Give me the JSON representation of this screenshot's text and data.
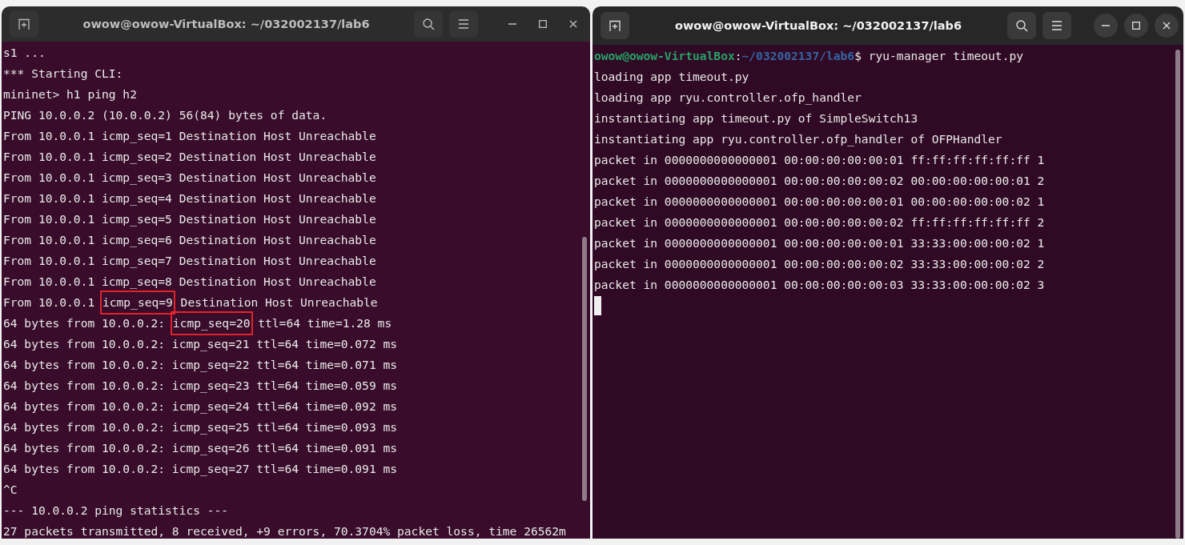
{
  "windows": [
    {
      "title": "owow@owow-VirtualBox: ~/032002137/lab6",
      "active": false,
      "lines": [
        {
          "parts": [
            {
              "kind": "plain",
              "text": "s1 ..."
            }
          ]
        },
        {
          "parts": [
            {
              "kind": "plain",
              "text": "*** Starting CLI:"
            }
          ]
        },
        {
          "parts": [
            {
              "kind": "plain",
              "text": "mininet> h1 ping h2"
            }
          ]
        },
        {
          "parts": [
            {
              "kind": "plain",
              "text": "PING 10.0.0.2 (10.0.0.2) 56(84) bytes of data."
            }
          ]
        },
        {
          "parts": [
            {
              "kind": "plain",
              "text": "From 10.0.0.1 icmp_seq=1 Destination Host Unreachable"
            }
          ]
        },
        {
          "parts": [
            {
              "kind": "plain",
              "text": "From 10.0.0.1 icmp_seq=2 Destination Host Unreachable"
            }
          ]
        },
        {
          "parts": [
            {
              "kind": "plain",
              "text": "From 10.0.0.1 icmp_seq=3 Destination Host Unreachable"
            }
          ]
        },
        {
          "parts": [
            {
              "kind": "plain",
              "text": "From 10.0.0.1 icmp_seq=4 Destination Host Unreachable"
            }
          ]
        },
        {
          "parts": [
            {
              "kind": "plain",
              "text": "From 10.0.0.1 icmp_seq=5 Destination Host Unreachable"
            }
          ]
        },
        {
          "parts": [
            {
              "kind": "plain",
              "text": "From 10.0.0.1 icmp_seq=6 Destination Host Unreachable"
            }
          ]
        },
        {
          "parts": [
            {
              "kind": "plain",
              "text": "From 10.0.0.1 icmp_seq=7 Destination Host Unreachable"
            }
          ]
        },
        {
          "parts": [
            {
              "kind": "plain",
              "text": "From 10.0.0.1 icmp_seq=8 Destination Host Unreachable"
            }
          ]
        },
        {
          "parts": [
            {
              "kind": "plain",
              "text": "From 10.0.0.1"
            },
            {
              "kind": "boxed",
              "text": "icmp_seq=9"
            },
            {
              "kind": "plain",
              "text": "Destination Host Unreachable"
            }
          ]
        },
        {
          "parts": [
            {
              "kind": "plain",
              "text": "64 bytes from 10.0.0.2:"
            },
            {
              "kind": "boxed",
              "text": "icmp_seq=20"
            },
            {
              "kind": "plain",
              "text": "ttl=64 time=1.28 ms"
            }
          ]
        },
        {
          "parts": [
            {
              "kind": "plain",
              "text": "64 bytes from 10.0.0.2: icmp_seq=21 ttl=64 time=0.072 ms"
            }
          ]
        },
        {
          "parts": [
            {
              "kind": "plain",
              "text": "64 bytes from 10.0.0.2: icmp_seq=22 ttl=64 time=0.071 ms"
            }
          ]
        },
        {
          "parts": [
            {
              "kind": "plain",
              "text": "64 bytes from 10.0.0.2: icmp_seq=23 ttl=64 time=0.059 ms"
            }
          ]
        },
        {
          "parts": [
            {
              "kind": "plain",
              "text": "64 bytes from 10.0.0.2: icmp_seq=24 ttl=64 time=0.092 ms"
            }
          ]
        },
        {
          "parts": [
            {
              "kind": "plain",
              "text": "64 bytes from 10.0.0.2: icmp_seq=25 ttl=64 time=0.093 ms"
            }
          ]
        },
        {
          "parts": [
            {
              "kind": "plain",
              "text": "64 bytes from 10.0.0.2: icmp_seq=26 ttl=64 time=0.091 ms"
            }
          ]
        },
        {
          "parts": [
            {
              "kind": "plain",
              "text": "64 bytes from 10.0.0.2: icmp_seq=27 ttl=64 time=0.091 ms"
            }
          ]
        },
        {
          "parts": [
            {
              "kind": "plain",
              "text": "^C"
            }
          ]
        },
        {
          "parts": [
            {
              "kind": "plain",
              "text": "--- 10.0.0.2 ping statistics ---"
            }
          ]
        },
        {
          "parts": [
            {
              "kind": "plain",
              "text": "27 packets transmitted, 8 received, +9 errors, 70.3704% packet loss, time 26562m"
            }
          ]
        }
      ]
    },
    {
      "title": "owow@owow-VirtualBox: ~/032002137/lab6",
      "active": true,
      "lines": [
        {
          "parts": [
            {
              "kind": "user",
              "text": "owow@owow-VirtualBox"
            },
            {
              "kind": "plain",
              "text": ":"
            },
            {
              "kind": "path",
              "text": "~/032002137/lab6"
            },
            {
              "kind": "plain",
              "text": "$ ryu-manager timeout.py"
            }
          ]
        },
        {
          "parts": [
            {
              "kind": "plain",
              "text": "loading app timeout.py"
            }
          ]
        },
        {
          "parts": [
            {
              "kind": "plain",
              "text": "loading app ryu.controller.ofp_handler"
            }
          ]
        },
        {
          "parts": [
            {
              "kind": "plain",
              "text": "instantiating app timeout.py of SimpleSwitch13"
            }
          ]
        },
        {
          "parts": [
            {
              "kind": "plain",
              "text": "instantiating app ryu.controller.ofp_handler of OFPHandler"
            }
          ]
        },
        {
          "parts": [
            {
              "kind": "plain",
              "text": "packet in 0000000000000001 00:00:00:00:00:01 ff:ff:ff:ff:ff:ff 1"
            }
          ]
        },
        {
          "parts": [
            {
              "kind": "plain",
              "text": "packet in 0000000000000001 00:00:00:00:00:02 00:00:00:00:00:01 2"
            }
          ]
        },
        {
          "parts": [
            {
              "kind": "plain",
              "text": "packet in 0000000000000001 00:00:00:00:00:01 00:00:00:00:00:02 1"
            }
          ]
        },
        {
          "parts": [
            {
              "kind": "plain",
              "text": "packet in 0000000000000001 00:00:00:00:00:02 ff:ff:ff:ff:ff:ff 2"
            }
          ]
        },
        {
          "parts": [
            {
              "kind": "plain",
              "text": "packet in 0000000000000001 00:00:00:00:00:01 33:33:00:00:00:02 1"
            }
          ]
        },
        {
          "parts": [
            {
              "kind": "plain",
              "text": "packet in 0000000000000001 00:00:00:00:00:02 33:33:00:00:00:02 2"
            }
          ]
        },
        {
          "parts": [
            {
              "kind": "plain",
              "text": "packet in 0000000000000001 00:00:00:00:00:03 33:33:00:00:00:02 3"
            }
          ]
        }
      ]
    }
  ]
}
